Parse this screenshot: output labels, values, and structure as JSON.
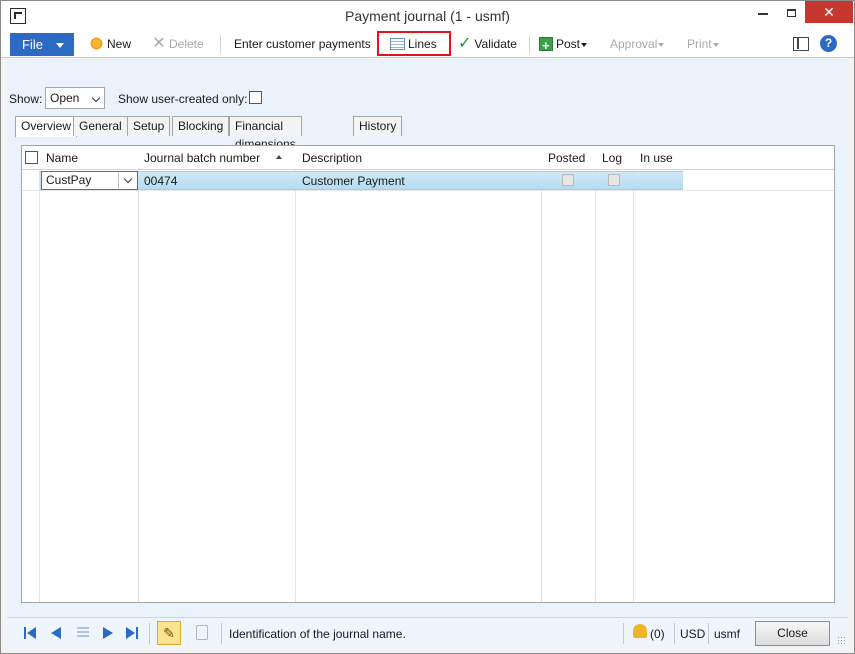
{
  "window": {
    "title": "Payment journal (1 - usmf)"
  },
  "toolbar": {
    "file": "File",
    "new": "New",
    "delete": "Delete",
    "enter_customer_payments": "Enter customer payments",
    "lines": "Lines",
    "validate": "Validate",
    "post": "Post",
    "approval": "Approval",
    "print": "Print"
  },
  "filter": {
    "show_label": "Show:",
    "show_value": "Open",
    "user_created_label": "Show user-created only:",
    "user_created_checked": false
  },
  "tabs": [
    "Overview",
    "General",
    "Setup",
    "Blocking",
    "Financial dimensions",
    "History"
  ],
  "active_tab": "Overview",
  "grid": {
    "columns": [
      "Name",
      "Journal batch number",
      "Description",
      "Posted",
      "Log",
      "In use"
    ],
    "sorted_column": "Journal batch number",
    "rows": [
      {
        "name": "CustPay",
        "journal_batch_number": "00474",
        "description": "Customer Payment",
        "posted": false,
        "log": false,
        "in_use": ""
      }
    ]
  },
  "statusbar": {
    "message": "Identification of the journal name.",
    "notifications": "(0)",
    "currency": "USD",
    "company": "usmf",
    "close": "Close"
  },
  "colors": {
    "accent": "#2d6ac4",
    "highlight_border": "#e0161c",
    "selected_row": "#b5dcf2"
  }
}
